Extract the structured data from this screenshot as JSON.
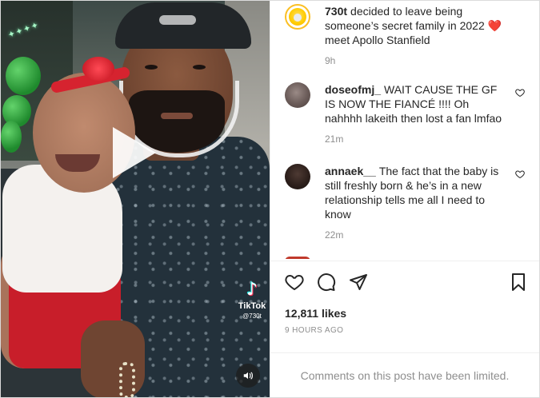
{
  "video": {
    "play_icon": "play-icon",
    "mute_icon": "speaker-icon",
    "tiktok_icon": "tiktok-icon",
    "tiktok_label": "TikTok",
    "tiktok_user": "@730t"
  },
  "comments": [
    {
      "username": "730t",
      "text": "decided to leave being someone’s secret family in 2022 ❤️ meet Apollo Stanfield",
      "time": "9h",
      "is_caption": true
    },
    {
      "username": "doseofmj_",
      "text": "WAIT CAUSE THE GF IS NOW THE FIANCÉ !!!! Oh nahhhh lakeith then lost a fan lmfao",
      "time": "21m",
      "is_caption": false
    },
    {
      "username": "annaek__",
      "text": "The fact that the baby is still freshly born & he’s in a new relationship tells me all I need to know",
      "time": "22m",
      "is_caption": false
    }
  ],
  "actions": {
    "like_icon": "heart-icon",
    "comment_icon": "comment-icon",
    "share_icon": "share-icon",
    "save_icon": "bookmark-icon"
  },
  "likes": "12,811 likes",
  "post_time": "9 HOURS AGO",
  "comments_limited": "Comments on this post have been limited.",
  "colors": {
    "text": "#262626",
    "secondary": "#8e8e8e",
    "divider": "#efefef"
  }
}
